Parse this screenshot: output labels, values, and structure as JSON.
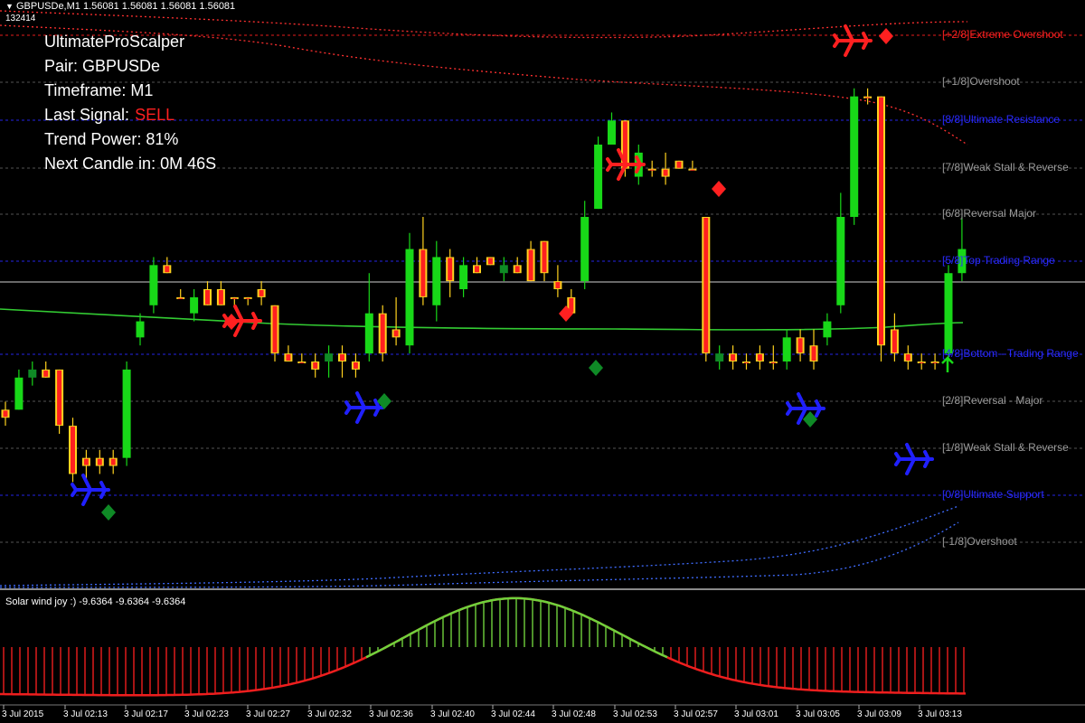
{
  "header": {
    "symbol_line": "GBPUSDe,M1  1.56081 1.56081 1.56081 1.56081",
    "sub_line": "132414",
    "menu_icon": "triangle-down-icon"
  },
  "info_panel": {
    "title": "UltimateProScalper",
    "pair": "Pair: GBPUSDe",
    "timeframe": "Timeframe: M1",
    "last_signal_label": "Last Signal:",
    "last_signal_value": "SELL",
    "trend_power": "Trend Power: 81%",
    "next_candle": "Next Candle in: 0M 46S"
  },
  "levels": [
    {
      "label": "[+2/8]Extreme Overshoot",
      "color": "#ff2020"
    },
    {
      "label": "[+1/8]Overshoot",
      "color": "#9a9a9a"
    },
    {
      "label": "[8/8]Ultimate Resistance",
      "color": "#2a2aff"
    },
    {
      "label": "[7/8]Weak Stall & Reverse",
      "color": "#9a9a9a"
    },
    {
      "label": "[6/8]Reversal Major",
      "color": "#9a9a9a"
    },
    {
      "label": "[5/8]Top Trading Range",
      "color": "#2a2aff"
    },
    {
      "label": "[4/8]Bottom - Trading Range",
      "color": "#2a2aff"
    },
    {
      "label": "[2/8]Reversal - Major",
      "color": "#9a9a9a"
    },
    {
      "label": "[1/8]Weak Stall & Reverse",
      "color": "#9a9a9a"
    },
    {
      "label": "[0/8]Ultimate Support",
      "color": "#2a2aff"
    },
    {
      "label": "[-1/8]Overshoot",
      "color": "#9a9a9a"
    }
  ],
  "indicator": {
    "label": "Solar wind joy :) -9.6364 -9.6364 -9.6364"
  },
  "time_axis": [
    "3 Jul 2015",
    "3 Jul 02:13",
    "3 Jul 02:17",
    "3 Jul 02:23",
    "3 Jul 02:27",
    "3 Jul 02:32",
    "3 Jul 02:36",
    "3 Jul 02:40",
    "3 Jul 02:44",
    "3 Jul 02:48",
    "3 Jul 02:53",
    "3 Jul 02:57",
    "3 Jul 03:01",
    "3 Jul 03:05",
    "3 Jul 03:09",
    "3 Jul 03:13"
  ],
  "colors": {
    "bull": "#18d818",
    "bear": "#ff2020",
    "bear_edge": "#ffd21e",
    "dark_bull": "#0f8a26",
    "sell_signal": "#ff2020",
    "buy_signal": "#2020ff",
    "level_blue": "#2a2aff",
    "level_gray": "#9a9a9a",
    "ma_green": "#33cc33",
    "osc_green": "#6fd13c",
    "osc_red": "#ee1e1e"
  },
  "chart_data": {
    "type": "candlestick",
    "candles": [
      {
        "o": 1.56,
        "h": 1.5601,
        "l": 1.5598,
        "c": 1.5599,
        "dir": "flat"
      },
      {
        "o": 1.56,
        "h": 1.5605,
        "l": 1.56,
        "c": 1.5604
      },
      {
        "o": 1.5604,
        "h": 1.5606,
        "l": 1.5603,
        "c": 1.5605
      },
      {
        "o": 1.5605,
        "h": 1.5606,
        "l": 1.5604,
        "c": 1.5604
      },
      {
        "o": 1.5605,
        "h": 1.5605,
        "l": 1.5597,
        "c": 1.5598
      },
      {
        "o": 1.5598,
        "h": 1.5599,
        "l": 1.5591,
        "c": 1.5592
      },
      {
        "o": 1.5594,
        "h": 1.5595,
        "l": 1.5591,
        "c": 1.5593
      },
      {
        "o": 1.5594,
        "h": 1.5595,
        "l": 1.5592,
        "c": 1.5593
      },
      {
        "o": 1.5594,
        "h": 1.5595,
        "l": 1.5592,
        "c": 1.5593
      },
      {
        "o": 1.5594,
        "h": 1.5606,
        "l": 1.5593,
        "c": 1.5605
      },
      {
        "o": 1.5609,
        "h": 1.5612,
        "l": 1.5608,
        "c": 1.5611
      },
      {
        "o": 1.5613,
        "h": 1.5619,
        "l": 1.5612,
        "c": 1.5618
      },
      {
        "o": 1.5618,
        "h": 1.5619,
        "l": 1.5617,
        "c": 1.5617
      },
      {
        "o": 1.5614,
        "h": 1.5615,
        "l": 1.5614,
        "c": 1.5614
      },
      {
        "o": 1.5612,
        "h": 1.5615,
        "l": 1.5611,
        "c": 1.5614
      },
      {
        "o": 1.5615,
        "h": 1.5616,
        "l": 1.5613,
        "c": 1.5613
      },
      {
        "o": 1.5615,
        "h": 1.5616,
        "l": 1.5613,
        "c": 1.5613
      },
      {
        "o": 1.5614,
        "h": 1.5614,
        "l": 1.5613,
        "c": 1.5614
      },
      {
        "o": 1.5614,
        "h": 1.5614,
        "l": 1.5613,
        "c": 1.5614
      },
      {
        "o": 1.5615,
        "h": 1.5616,
        "l": 1.5613,
        "c": 1.5614
      },
      {
        "o": 1.5613,
        "h": 1.5613,
        "l": 1.5606,
        "c": 1.5607
      },
      {
        "o": 1.5607,
        "h": 1.5608,
        "l": 1.5606,
        "c": 1.5606
      },
      {
        "o": 1.5606,
        "h": 1.5607,
        "l": 1.5606,
        "c": 1.5606
      },
      {
        "o": 1.5606,
        "h": 1.5607,
        "l": 1.5604,
        "c": 1.5605
      },
      {
        "o": 1.5606,
        "h": 1.5608,
        "l": 1.5604,
        "c": 1.5607
      },
      {
        "o": 1.5607,
        "h": 1.5608,
        "l": 1.5604,
        "c": 1.5606
      },
      {
        "o": 1.5606,
        "h": 1.5607,
        "l": 1.5604,
        "c": 1.5605
      },
      {
        "o": 1.5607,
        "h": 1.5617,
        "l": 1.5606,
        "c": 1.5612
      },
      {
        "o": 1.5612,
        "h": 1.5613,
        "l": 1.5606,
        "c": 1.5607
      },
      {
        "o": 1.561,
        "h": 1.5614,
        "l": 1.5608,
        "c": 1.5609
      },
      {
        "o": 1.5608,
        "h": 1.5622,
        "l": 1.5607,
        "c": 1.562
      },
      {
        "o": 1.562,
        "h": 1.5624,
        "l": 1.5613,
        "c": 1.5614
      },
      {
        "o": 1.5613,
        "h": 1.5621,
        "l": 1.5611,
        "c": 1.5619
      },
      {
        "o": 1.5619,
        "h": 1.562,
        "l": 1.5614,
        "c": 1.5616
      },
      {
        "o": 1.5615,
        "h": 1.5619,
        "l": 1.5614,
        "c": 1.5618
      },
      {
        "o": 1.5618,
        "h": 1.5619,
        "l": 1.5617,
        "c": 1.5617
      },
      {
        "o": 1.5619,
        "h": 1.5619,
        "l": 1.5618,
        "c": 1.5618
      },
      {
        "o": 1.5617,
        "h": 1.5619,
        "l": 1.5616,
        "c": 1.5618
      },
      {
        "o": 1.5618,
        "h": 1.5619,
        "l": 1.5617,
        "c": 1.5617
      },
      {
        "o": 1.562,
        "h": 1.5621,
        "l": 1.5616,
        "c": 1.5616
      },
      {
        "o": 1.5621,
        "h": 1.5621,
        "l": 1.5616,
        "c": 1.5617
      },
      {
        "o": 1.5616,
        "h": 1.5618,
        "l": 1.5614,
        "c": 1.5615
      },
      {
        "o": 1.5614,
        "h": 1.5615,
        "l": 1.5612,
        "c": 1.5612
      },
      {
        "o": 1.5616,
        "h": 1.5626,
        "l": 1.5615,
        "c": 1.5624
      },
      {
        "o": 1.5625,
        "h": 1.5634,
        "l": 1.5625,
        "c": 1.5633
      },
      {
        "o": 1.5633,
        "h": 1.5637,
        "l": 1.5633,
        "c": 1.5636
      },
      {
        "o": 1.5636,
        "h": 1.5636,
        "l": 1.5629,
        "c": 1.563
      },
      {
        "o": 1.5629,
        "h": 1.5633,
        "l": 1.5628,
        "c": 1.5632
      },
      {
        "o": 1.563,
        "h": 1.5631,
        "l": 1.5629,
        "c": 1.563
      },
      {
        "o": 1.563,
        "h": 1.5632,
        "l": 1.5628,
        "c": 1.5629
      },
      {
        "o": 1.5631,
        "h": 1.5631,
        "l": 1.563,
        "c": 1.563
      },
      {
        "o": 1.563,
        "h": 1.5631,
        "l": 1.563,
        "c": 1.563
      },
      {
        "o": 1.5624,
        "h": 1.5624,
        "l": 1.5606,
        "c": 1.5607
      },
      {
        "o": 1.5606,
        "h": 1.5608,
        "l": 1.5605,
        "c": 1.5607
      },
      {
        "o": 1.5607,
        "h": 1.5608,
        "l": 1.5605,
        "c": 1.5606
      },
      {
        "o": 1.5606,
        "h": 1.5607,
        "l": 1.5605,
        "c": 1.5606
      },
      {
        "o": 1.5607,
        "h": 1.5608,
        "l": 1.5605,
        "c": 1.5606
      },
      {
        "o": 1.5606,
        "h": 1.5608,
        "l": 1.5605,
        "c": 1.5606
      },
      {
        "o": 1.5606,
        "h": 1.561,
        "l": 1.5605,
        "c": 1.5609
      },
      {
        "o": 1.5609,
        "h": 1.561,
        "l": 1.5606,
        "c": 1.5607
      },
      {
        "o": 1.5608,
        "h": 1.561,
        "l": 1.5605,
        "c": 1.5606
      },
      {
        "o": 1.5609,
        "h": 1.5612,
        "l": 1.5608,
        "c": 1.5611
      },
      {
        "o": 1.5613,
        "h": 1.5627,
        "l": 1.5612,
        "c": 1.5624
      },
      {
        "o": 1.5624,
        "h": 1.564,
        "l": 1.5623,
        "c": 1.5639
      },
      {
        "o": 1.5639,
        "h": 1.564,
        "l": 1.5638,
        "c": 1.5639
      },
      {
        "o": 1.5639,
        "h": 1.5639,
        "l": 1.5606,
        "c": 1.5608
      },
      {
        "o": 1.561,
        "h": 1.5612,
        "l": 1.5606,
        "c": 1.5607
      },
      {
        "o": 1.5607,
        "h": 1.5608,
        "l": 1.5605,
        "c": 1.5606
      },
      {
        "o": 1.5606,
        "h": 1.5607,
        "l": 1.5605,
        "c": 1.5606
      },
      {
        "o": 1.5606,
        "h": 1.5607,
        "l": 1.5605,
        "c": 1.5606
      },
      {
        "o": 1.5607,
        "h": 1.5618,
        "l": 1.5606,
        "c": 1.5617
      },
      {
        "o": 1.5617,
        "h": 1.5624,
        "l": 1.5616,
        "c": 1.562
      }
    ]
  }
}
